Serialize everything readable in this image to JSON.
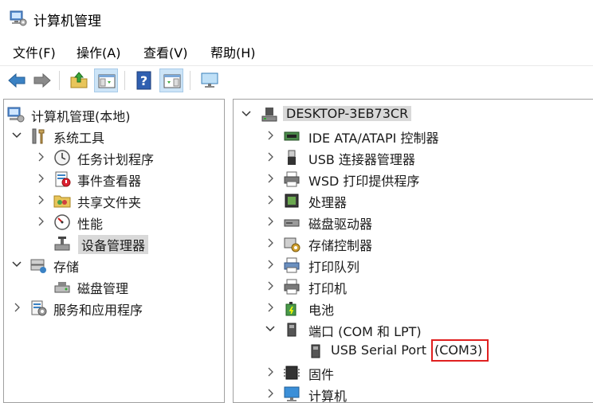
{
  "window": {
    "title": "计算机管理"
  },
  "menu": [
    "文件(F)",
    "操作(A)",
    "查看(V)",
    "帮助(H)"
  ],
  "toolbar": {
    "icons": [
      "back-arrow-icon",
      "forward-arrow-icon",
      "up-folder-icon",
      "show-console-tree-icon",
      "help-icon",
      "show-action-pane-icon",
      "monitor-icon"
    ]
  },
  "left_tree": {
    "root": "计算机管理(本地)",
    "system_tools": {
      "label": "系统工具",
      "children": [
        "任务计划程序",
        "事件查看器",
        "共享文件夹",
        "性能",
        "设备管理器"
      ]
    },
    "storage": {
      "label": "存储",
      "children": [
        "磁盘管理"
      ]
    },
    "services": "服务和应用程序"
  },
  "right_tree": {
    "computer_name": "DESKTOP-3EB73CR",
    "categories": [
      "IDE ATA/ATAPI 控制器",
      "USB 连接器管理器",
      "WSD 打印提供程序",
      "处理器",
      "磁盘驱动器",
      "存储控制器",
      "打印队列",
      "打印机",
      "电池",
      "端口 (COM 和 LPT)",
      "固件",
      "计算机"
    ],
    "port_device": {
      "name": "USB Serial Port",
      "port": "(COM3)"
    },
    "highlight_color": "#e02020"
  }
}
